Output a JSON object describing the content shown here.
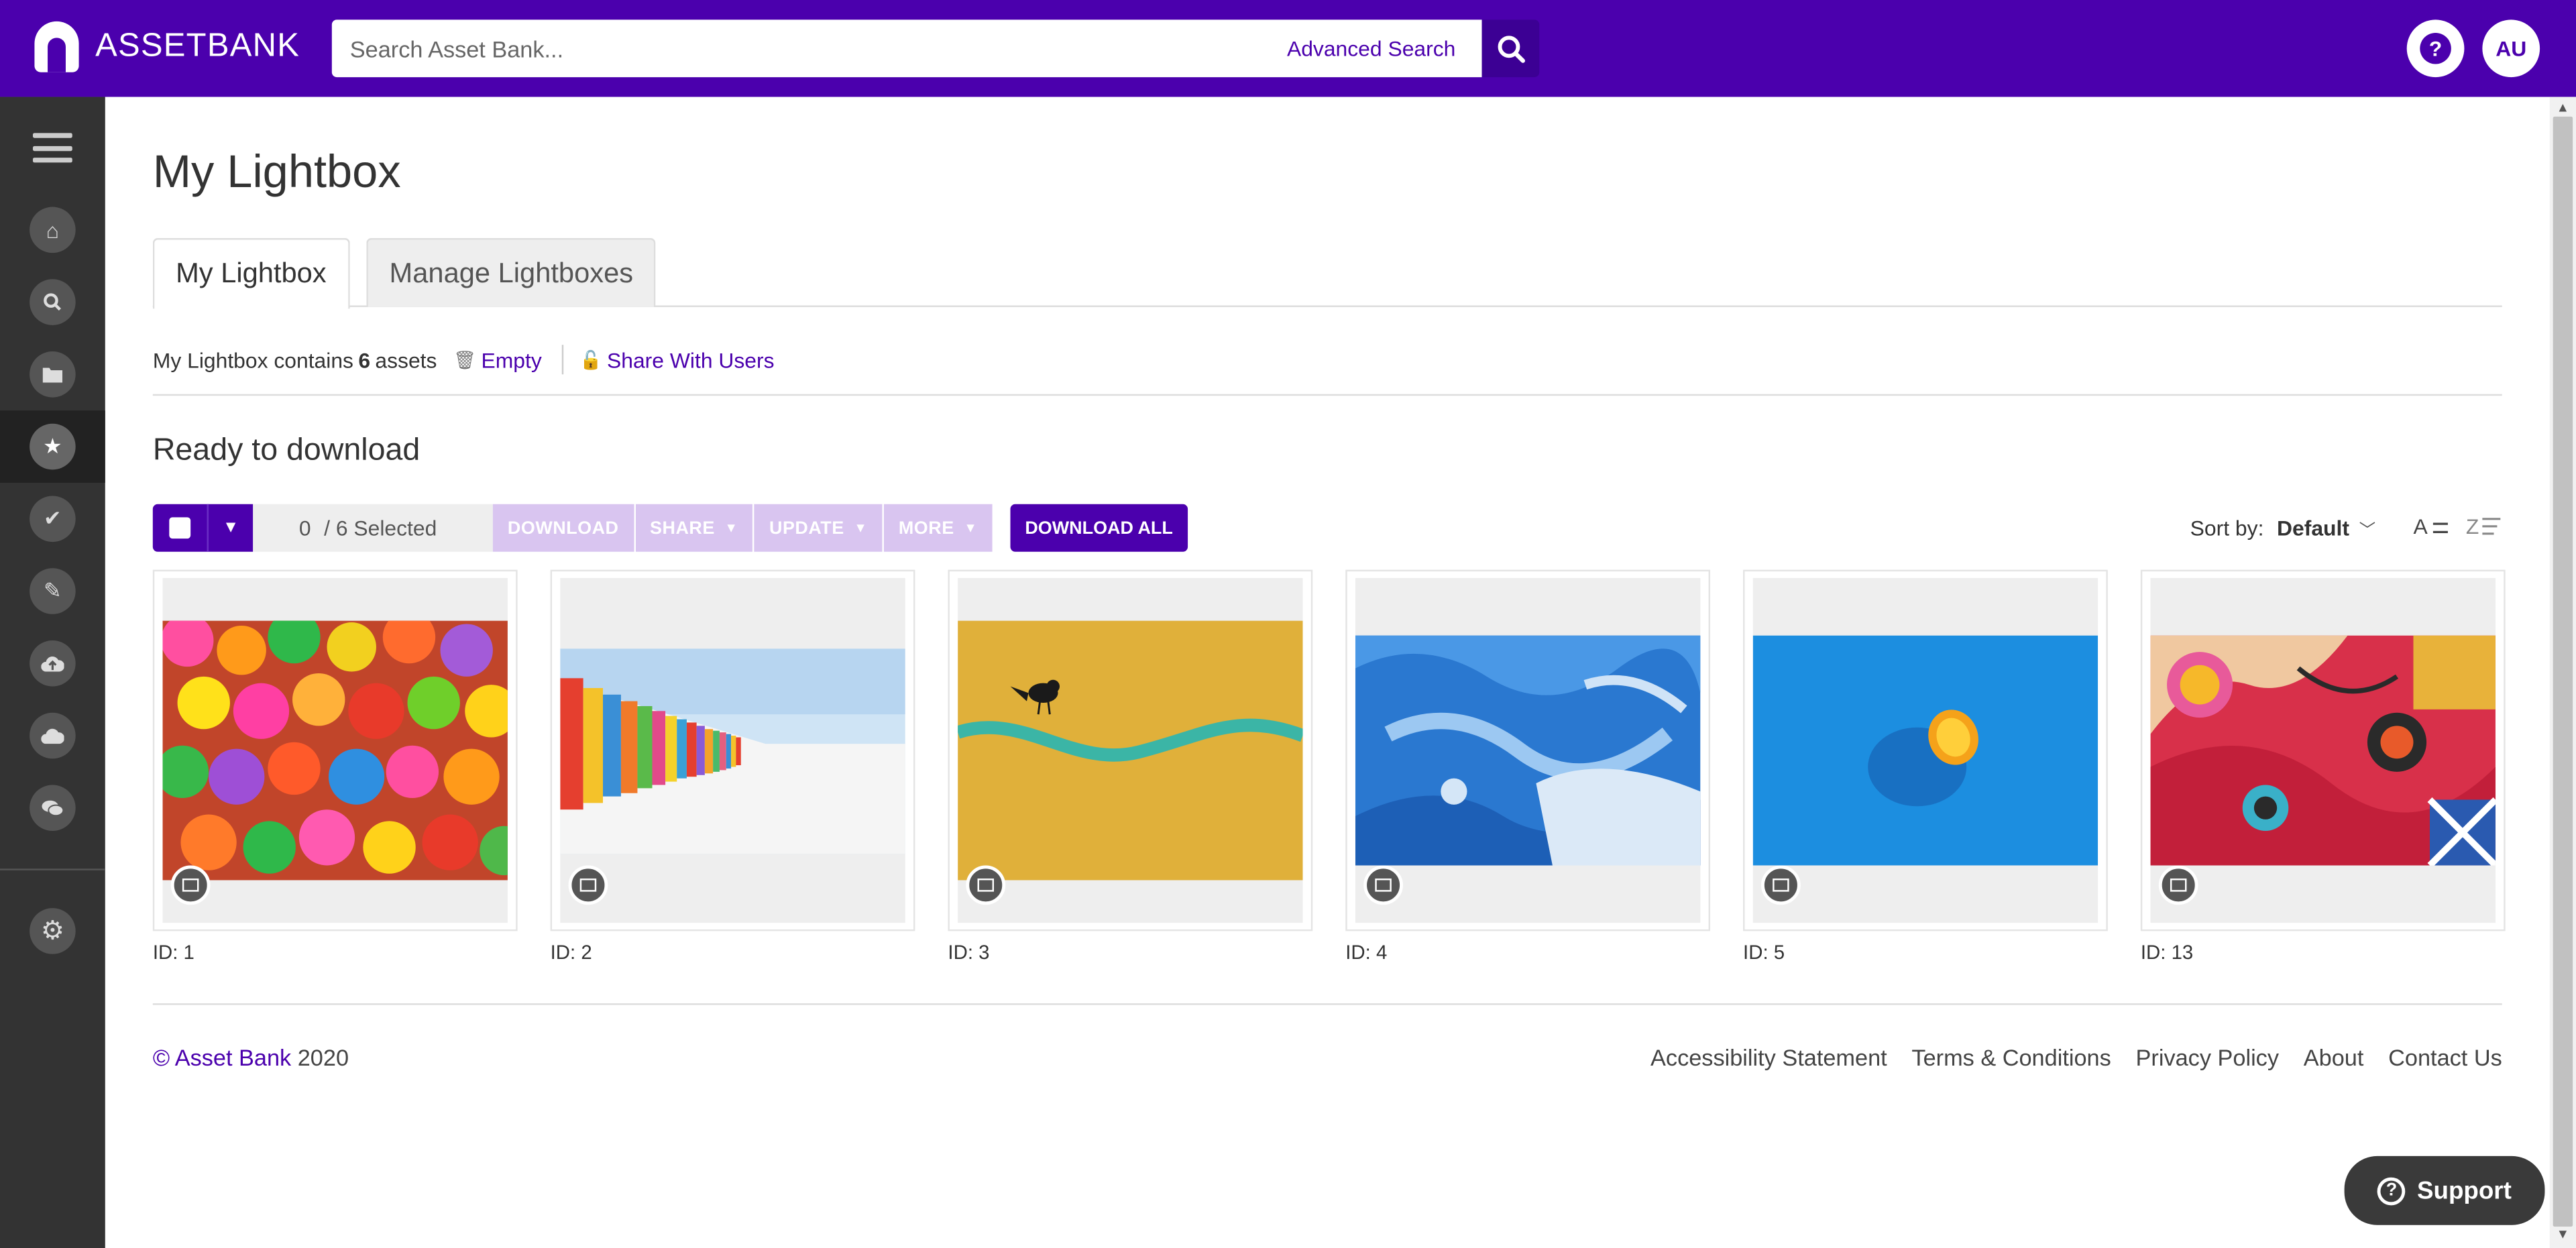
{
  "header": {
    "brand": "ASSETBANK",
    "search_placeholder": "Search Asset Bank...",
    "advanced_search": "Advanced Search",
    "help": "?",
    "avatar_initials": "AU",
    "brand_color": "#4b00ad"
  },
  "sidebar": {
    "items": [
      "home-icon",
      "search-icon",
      "folder-icon",
      "star-icon",
      "check-icon",
      "pencil-icon",
      "cloud-upload-icon",
      "cloud-icon",
      "comments-icon"
    ],
    "active": "star-icon",
    "settings": "gear-icon"
  },
  "main": {
    "title": "My Lightbox",
    "tabs": [
      "My Lightbox",
      "Manage Lightboxes"
    ],
    "info_prefix": "My Lightbox contains",
    "count": "6",
    "info_suffix": "assets",
    "empty": "Empty",
    "share": "Share With Users",
    "section_title": "Ready to download"
  },
  "toolbar": {
    "selected_count": "0",
    "selected_total": "/ 6 Selected",
    "download": "DOWNLOAD",
    "share": "SHARE",
    "update": "UPDATE",
    "more": "MORE",
    "download_all": "DOWNLOAD ALL",
    "sort_label": "Sort by:",
    "sort_value": "Default"
  },
  "assets": [
    {
      "id": "ID: 1",
      "subject": "colorful balls"
    },
    {
      "id": "ID: 2",
      "subject": "beach huts"
    },
    {
      "id": "ID: 3",
      "subject": "bird on wall"
    },
    {
      "id": "ID: 4",
      "subject": "blue marble"
    },
    {
      "id": "ID: 5",
      "subject": "blue lemon"
    },
    {
      "id": "ID: 13",
      "subject": "patterned art"
    }
  ],
  "footer": {
    "copyright_link": "© Asset Bank",
    "year": "2020",
    "links": [
      "Accessibility Statement",
      "Terms & Conditions",
      "Privacy Policy",
      "About",
      "Contact Us"
    ]
  },
  "support": "Support"
}
